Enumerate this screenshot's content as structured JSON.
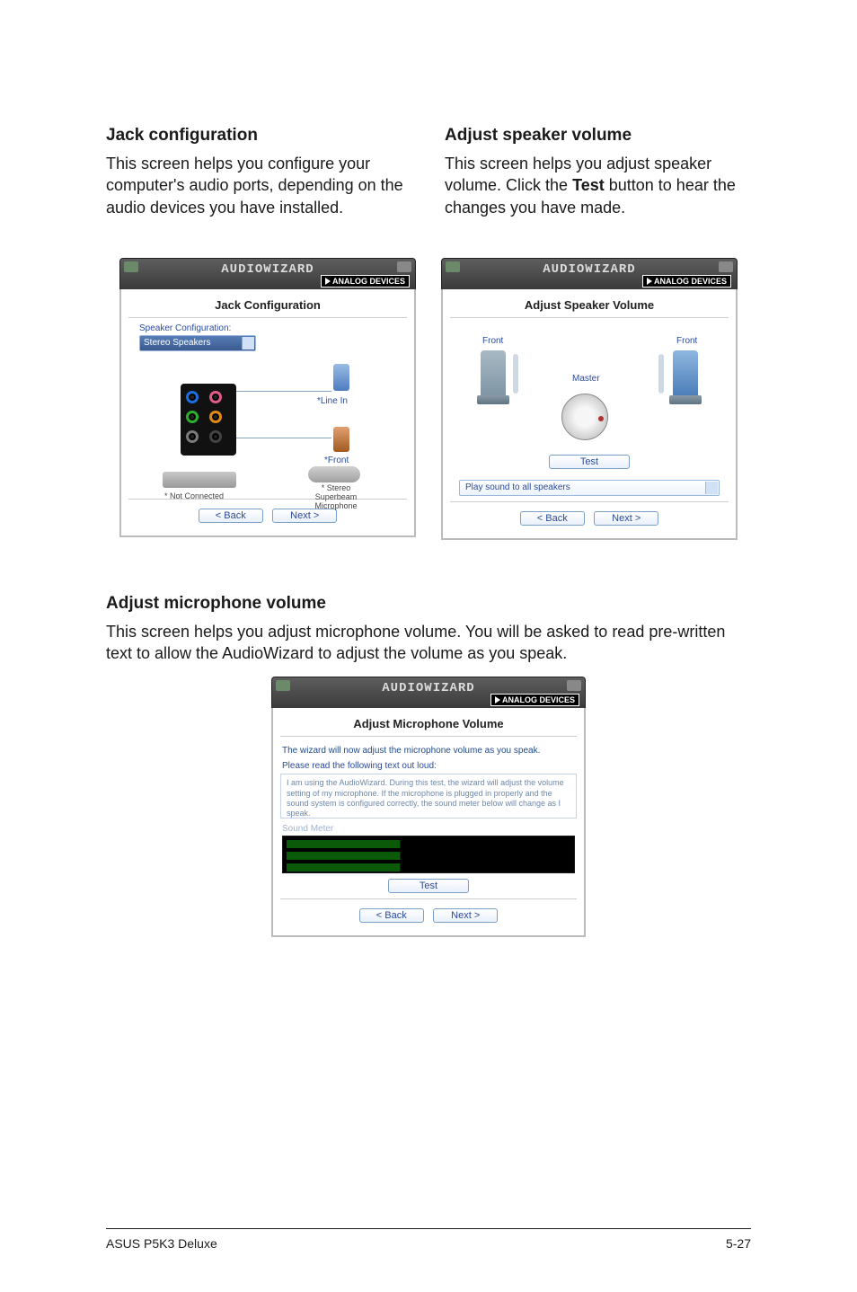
{
  "sections": {
    "jack": {
      "title": "Jack configuration",
      "body": "This screen helps you configure your computer's audio ports, depending on the audio devices you have installed."
    },
    "speaker": {
      "title": "Adjust speaker volume",
      "body_pre": "This screen helps you adjust speaker volume. Click the ",
      "body_bold": "Test",
      "body_post": " button to hear the changes you have made."
    },
    "mic": {
      "title": "Adjust microphone volume",
      "body": "This screen helps you adjust microphone volume. You will be asked to read pre-written text to allow the AudioWizard to adjust the volume as you speak."
    }
  },
  "wizard": {
    "app_title": "AUDIOWIZARD",
    "analog_label": "ANALOG DEVICES",
    "buttons": {
      "back": "< Back",
      "next": "Next >",
      "test": "Test"
    }
  },
  "jack_wizard": {
    "title": "Jack Configuration",
    "config_label": "Speaker Configuration:",
    "select_value": "Stereo Speakers",
    "line_in_label": "*Line In",
    "front_label": "*Front",
    "not_connected": "* Not Connected",
    "mic_label": "* Stereo Superbeam Microphone"
  },
  "speaker_wizard": {
    "title": "Adjust Speaker Volume",
    "front_left": "Front",
    "front_right": "Front",
    "master": "Master",
    "play_select": "Play sound to all speakers"
  },
  "mic_wizard": {
    "title": "Adjust Microphone Volume",
    "desc": "The wizard will now adjust the microphone volume as you speak.",
    "read_label": "Please read the following text out loud:",
    "read_text": "I am using the AudioWizard. During this test, the wizard will adjust the volume setting of my microphone. If the microphone is plugged in properly and the sound system is configured correctly, the sound meter below will change as I speak.",
    "meter_label": "Sound Meter"
  },
  "footer": {
    "left": "ASUS P5K3 Deluxe",
    "right": "5-27"
  }
}
